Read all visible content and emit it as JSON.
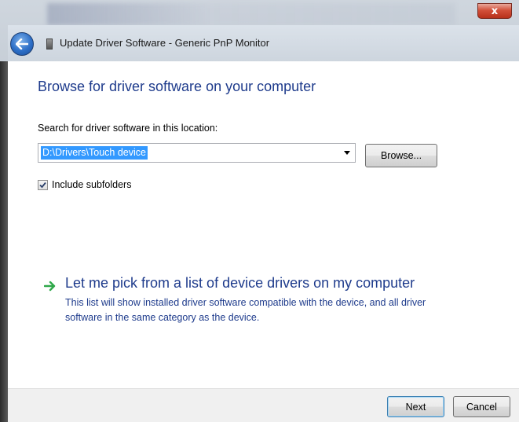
{
  "window": {
    "title": "Update Driver Software - Generic PnP Monitor",
    "close_glyph": "x"
  },
  "main": {
    "heading": "Browse for driver software on your computer",
    "search_label": "Search for driver software in this location:",
    "location_value": "D:\\Drivers\\Touch device",
    "browse_label": "Browse...",
    "include_subfolders_label": "Include subfolders",
    "include_subfolders_checked": true,
    "pick_title": "Let me pick from a list of device drivers on my computer",
    "pick_description": "This list will show installed driver software compatible with the device, and all driver software in the same category as the device."
  },
  "footer": {
    "next_label": "Next",
    "cancel_label": "Cancel"
  },
  "icons": {
    "back": "back-arrow-icon",
    "device": "device-icon",
    "pick_arrow": "green-arrow-icon",
    "dropdown": "chevron-down-icon",
    "check": "checkmark-icon"
  },
  "colors": {
    "heading": "#1e3b8c",
    "selection": "#3399ff",
    "arrow_green": "#2fa84a",
    "close_red": "#c7402a"
  }
}
